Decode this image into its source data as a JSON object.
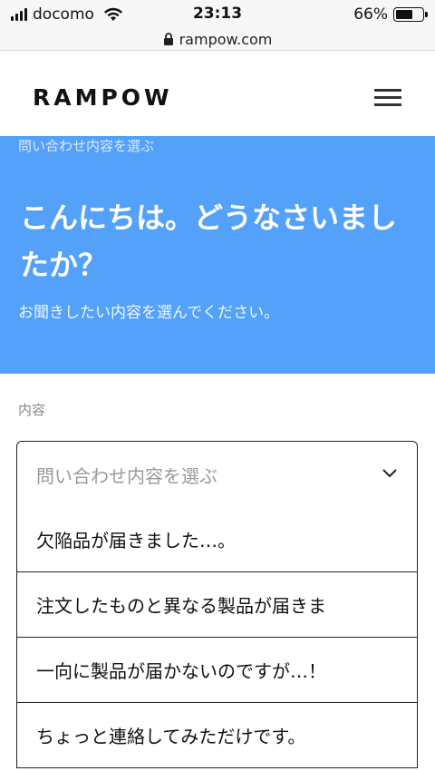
{
  "status_bar": {
    "carrier": "docomo",
    "time": "23:13",
    "battery_percent": "66%",
    "battery_level": 0.66,
    "icons": [
      "signal-icon",
      "wifi-icon",
      "battery-icon"
    ]
  },
  "url_bar": {
    "domain": "rampow.com",
    "icon": "lock-icon"
  },
  "header": {
    "logo": "RAMPOW",
    "menu_icon": "hamburger-menu-icon"
  },
  "hero": {
    "breadcrumb": "問い合わせ内容を選ぶ",
    "title": "こんにちは。どうなさいましたか？",
    "subtitle": "お聞きしたい内容を選んでください。",
    "background_color": "#53a1f9"
  },
  "form": {
    "label": "内容",
    "select_placeholder": "問い合わせ内容を選ぶ",
    "options": [
      "欠陥品が届きました…。",
      "注文したものと異なる製品が届きま",
      "一向に製品が届かないのですが…！",
      "ちょっと連絡してみただけです。"
    ]
  }
}
